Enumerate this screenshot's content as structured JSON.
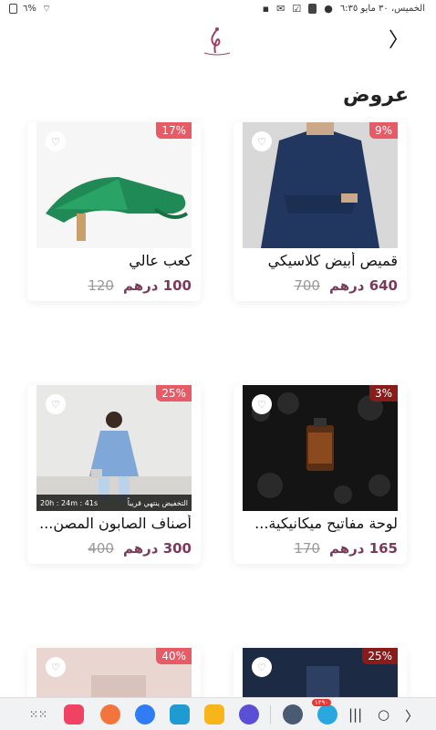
{
  "status_bar": {
    "date_time": "الخميس، ٣٠ مايو ٦:٣٥",
    "battery": "٦%"
  },
  "header": {
    "back_icon": "chevron-right-icon",
    "logo": "brand-logo"
  },
  "section": {
    "title": "عروض"
  },
  "products": [
    {
      "name": "قميص أبيض كلاسيكي",
      "price": "640 درهم",
      "old_price": "700",
      "discount": "9%"
    },
    {
      "name": "كعب عالي",
      "price": "100 درهم",
      "old_price": "120",
      "discount": "17%"
    },
    {
      "name": "لوحة مفاتيح ميكانيكية...",
      "price": "165 درهم",
      "old_price": "170",
      "discount": "3%"
    },
    {
      "name": "أصناف الصابون المصن...",
      "price": "300 درهم",
      "old_price": "400",
      "discount": "25%",
      "timer_label": "التخفيض ينتهي قريباً",
      "timer_value": "20h : 24m : 41s"
    },
    {
      "discount": "25%"
    },
    {
      "discount": "40%"
    }
  ],
  "taskbar": {
    "apps": [
      "apps-grid-icon",
      "camera-app-icon",
      "contacts-app-icon",
      "messages-app-icon",
      "calendar-app-icon",
      "files-app-icon",
      "internet-app-icon",
      "settings-app-icon",
      "telegram-app-icon"
    ],
    "telegram_badge": "١٢٩٠",
    "recents": "recents-icon",
    "home": "home-icon",
    "back": "back-nav-icon"
  }
}
